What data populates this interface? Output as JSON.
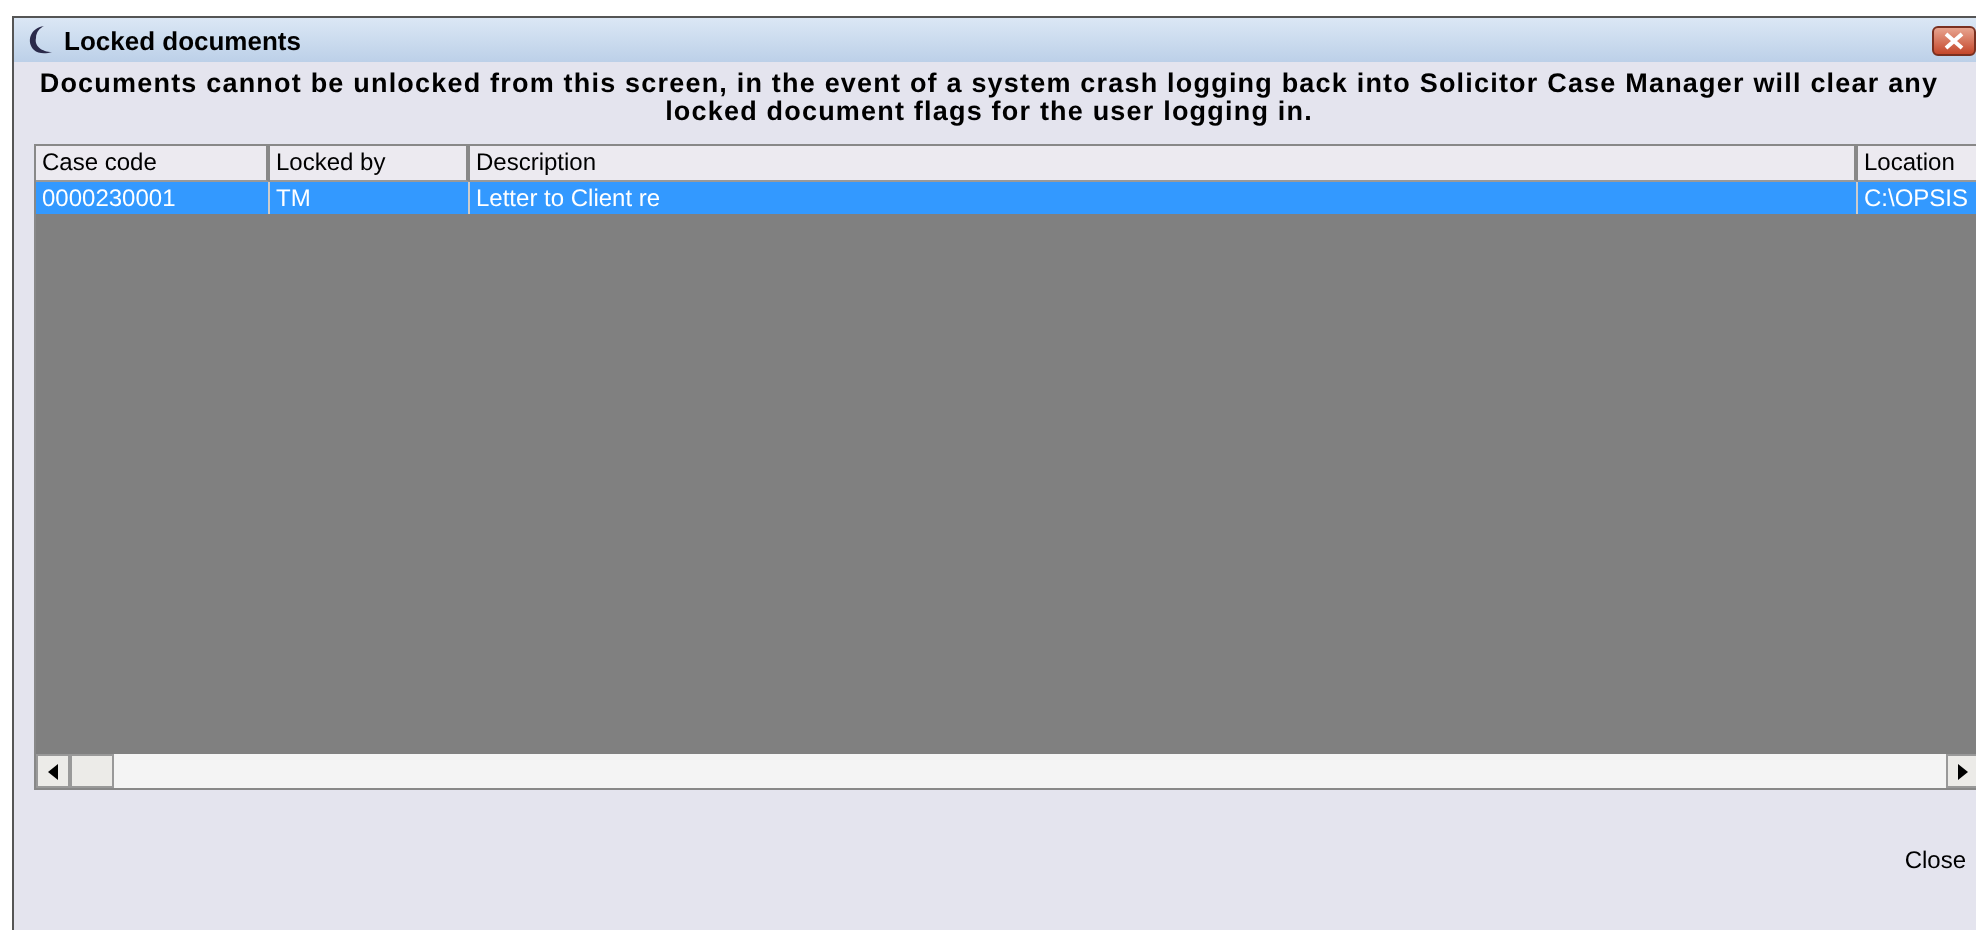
{
  "window": {
    "title": "Locked documents"
  },
  "message": "Documents cannot be unlocked from this screen, in the event of a system crash logging back into Solicitor Case Manager will clear any locked document flags for the user logging in.",
  "table": {
    "columns": [
      "Case code",
      "Locked by",
      "Description",
      "Location"
    ],
    "rows": [
      {
        "cells": [
          "0000230001",
          "TM",
          "Letter to Client re",
          "C:\\OPSIS"
        ],
        "selected": true
      }
    ]
  },
  "buttons": [
    "Close"
  ]
}
